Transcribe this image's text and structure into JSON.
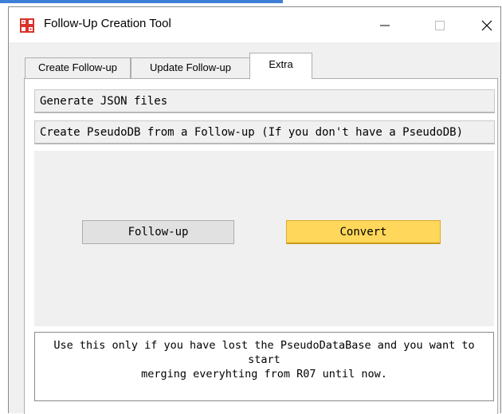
{
  "window": {
    "title": "Follow-Up Creation Tool",
    "icon": "app-grid-icon",
    "controls": {
      "minimize": "minimize-icon",
      "maximize": "maximize-icon",
      "close": "close-icon"
    }
  },
  "tabs": [
    {
      "label": "Create Follow-up",
      "active": false
    },
    {
      "label": "Update Follow-up",
      "active": false
    },
    {
      "label": "Extra",
      "active": true
    }
  ],
  "extra": {
    "generate_json_label": "Generate JSON files",
    "create_pseudodb_label": "Create PseudoDB from a Follow-up (If you don't have a PseudoDB)",
    "followup_button_label": "Follow-up",
    "convert_button_label": "Convert",
    "info_text_line1": "Use this only if you have lost the PseudoDataBase and you want to start",
    "info_text_line2": "merging everyhting from R07 until now."
  },
  "colors": {
    "accent": "#3d7fd6",
    "app_icon": "#d9322b",
    "convert_button": "#ffd75a"
  }
}
